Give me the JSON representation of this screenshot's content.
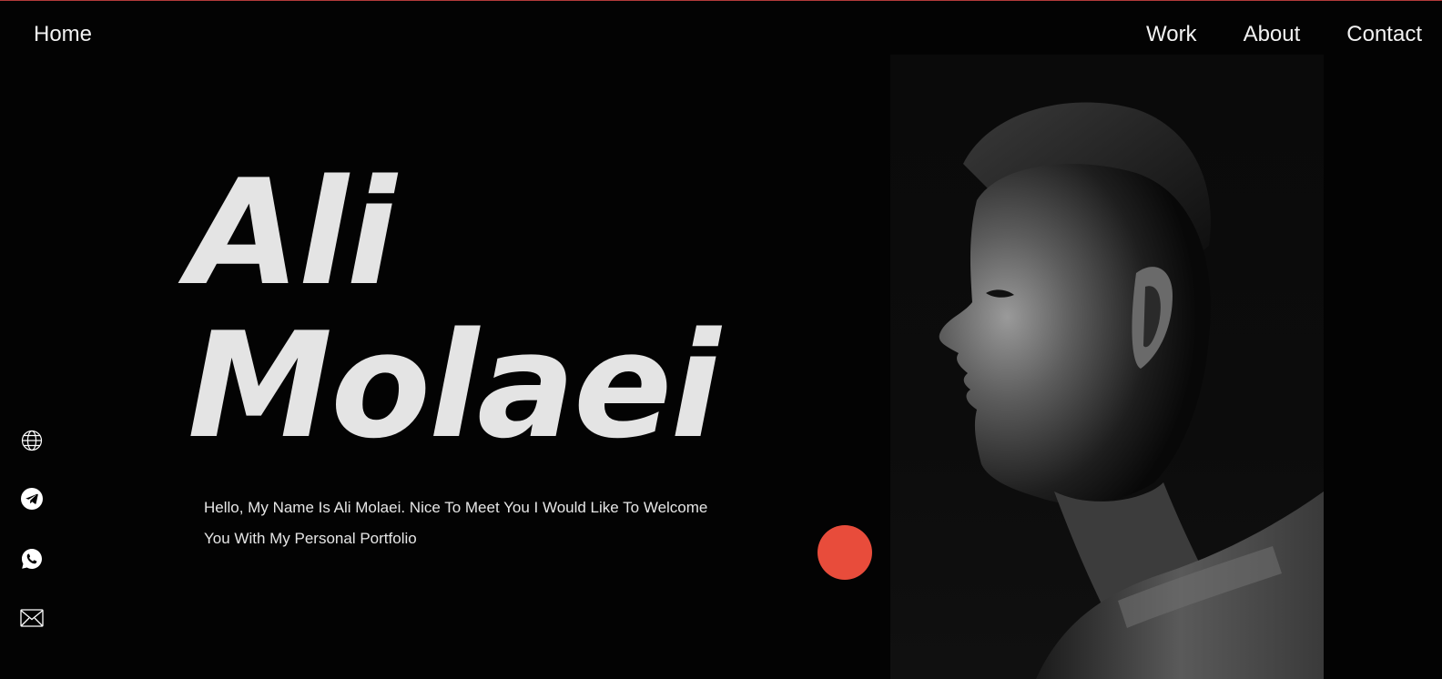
{
  "nav": {
    "home": "Home",
    "links": [
      "Work",
      "About",
      "Contact"
    ]
  },
  "hero": {
    "first_name": "Ali",
    "last_name": "Molaei",
    "intro": "Hello, My Name Is Ali Molaei. Nice To Meet You I Would Like To Welcome You With My Personal Portfolio"
  },
  "social_icons": [
    "globe-icon",
    "telegram-icon",
    "whatsapp-icon",
    "mail-icon"
  ],
  "colors": {
    "background": "#030303",
    "text": "#e6e6e6",
    "accent": "#e84c3b",
    "top_border": "#b23a3a"
  }
}
